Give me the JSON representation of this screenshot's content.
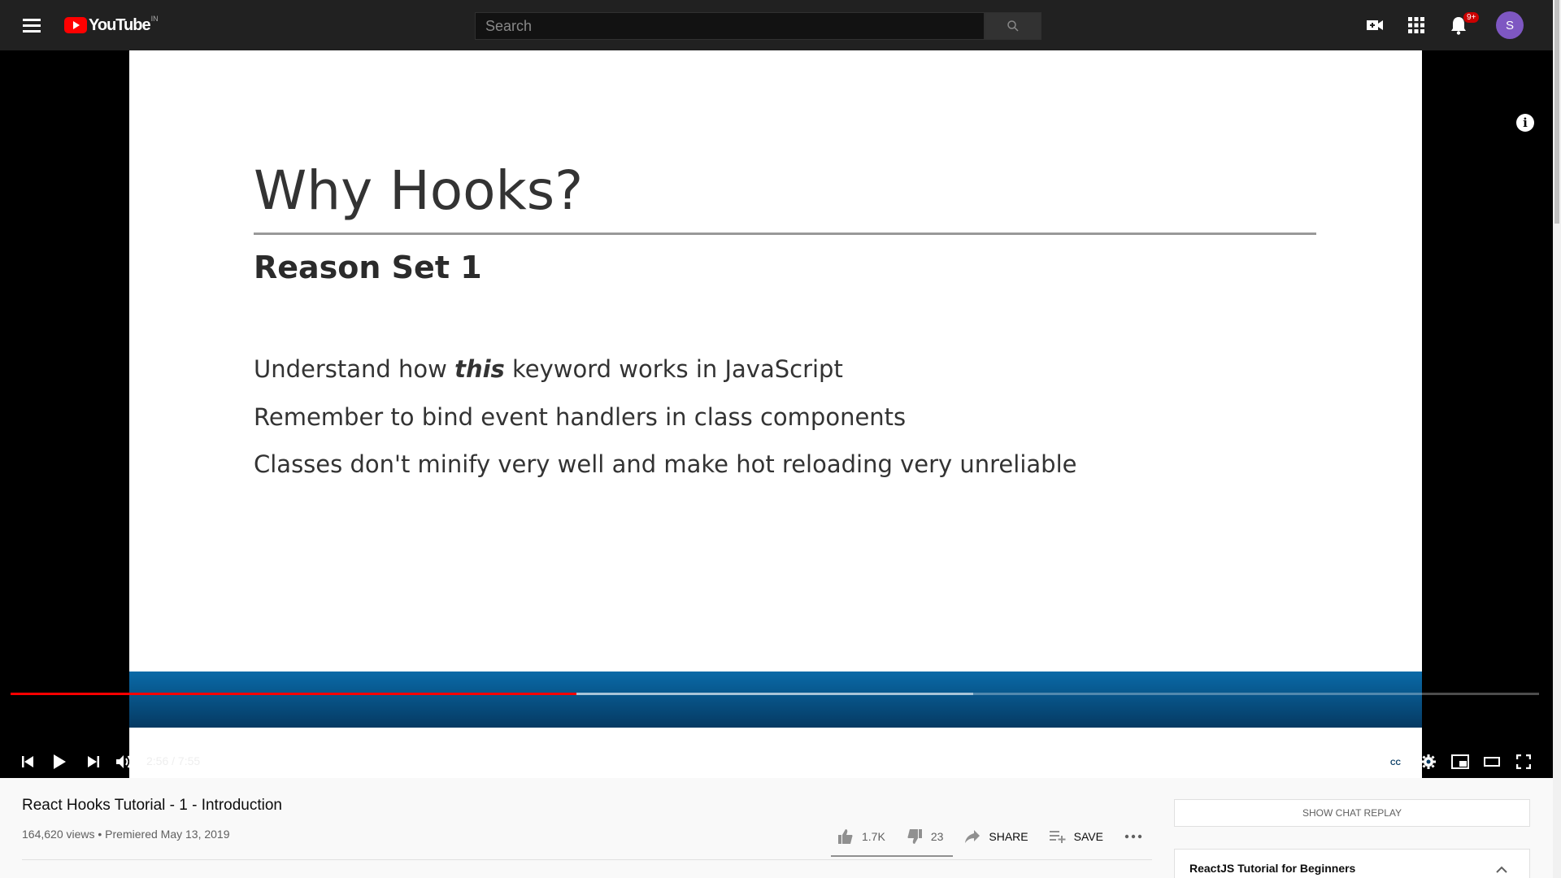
{
  "header": {
    "logo_text": "YouTube",
    "region": "IN",
    "search_placeholder": "Search",
    "notification_count": "9+",
    "avatar_letter": "S"
  },
  "slide": {
    "title": "Why Hooks?",
    "subtitle": "Reason Set 1",
    "bullets": [
      {
        "before": "Understand how ",
        "emph": "this",
        "after": " keyword works in JavaScript"
      },
      {
        "text": "Remember to bind event handlers in class components"
      },
      {
        "text": "Classes don't minify very well and make hot reloading very unreliable"
      }
    ]
  },
  "player": {
    "time_display": "2:56 / 7:55",
    "played_fraction": 0.37,
    "loaded_fraction": 0.63
  },
  "video": {
    "title": "React Hooks Tutorial - 1 - Introduction",
    "meta": "164,620 views • Premiered May 13, 2019",
    "likes": "1.7K",
    "dislikes": "23",
    "share_label": "SHARE",
    "save_label": "SAVE"
  },
  "sidebar": {
    "chat_replay_label": "SHOW CHAT REPLAY",
    "playlist_title": "ReactJS Tutorial for Beginners"
  },
  "colors": {
    "topbar": "#212121",
    "progress_played": "#ff0000",
    "avatar": "#7e57c2",
    "accent": "#cc0000"
  }
}
